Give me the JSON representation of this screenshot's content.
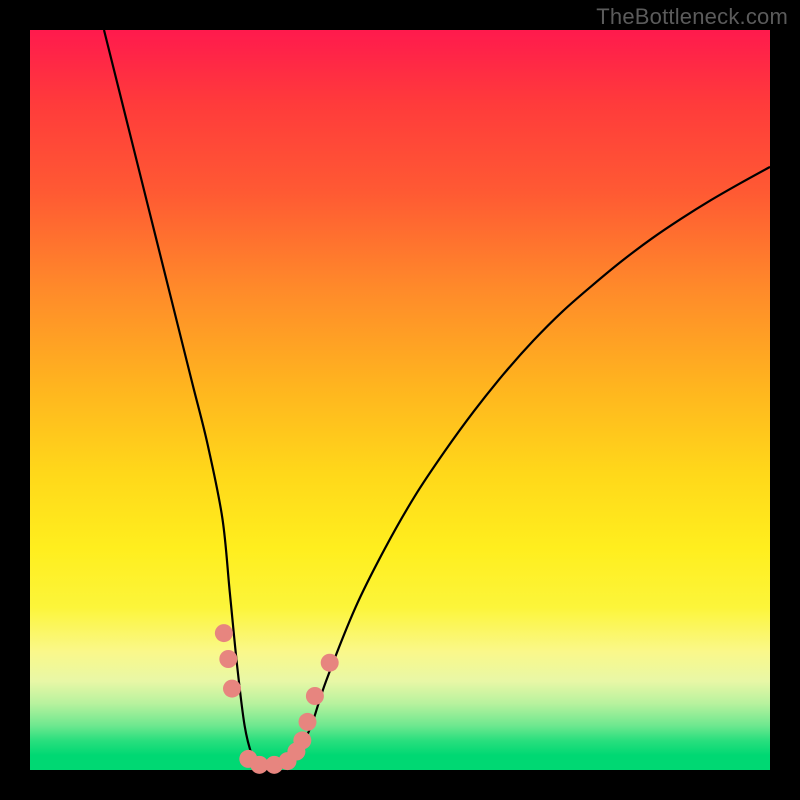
{
  "watermark": "TheBottleneck.com",
  "chart_data": {
    "type": "line",
    "title": "",
    "xlabel": "",
    "ylabel": "",
    "xlim": [
      0,
      100
    ],
    "ylim": [
      0,
      100
    ],
    "series": [
      {
        "name": "curve",
        "x": [
          10,
          12,
          14,
          16,
          18,
          20,
          22,
          24,
          26,
          27,
          28,
          29,
          30,
          31,
          32,
          34,
          36,
          38,
          40,
          44,
          48,
          52,
          56,
          60,
          64,
          68,
          72,
          76,
          80,
          84,
          88,
          92,
          96,
          100
        ],
        "values": [
          100,
          92,
          84,
          76,
          68,
          60,
          52,
          44,
          34,
          24,
          14,
          6,
          2,
          0.5,
          0.5,
          0.5,
          2,
          6,
          12,
          22,
          30,
          37,
          43,
          48.5,
          53.5,
          58,
          62,
          65.5,
          68.8,
          71.8,
          74.5,
          77,
          79.3,
          81.5
        ]
      }
    ],
    "markers": [
      {
        "x": 26.2,
        "y": 18.5
      },
      {
        "x": 26.8,
        "y": 15.0
      },
      {
        "x": 27.3,
        "y": 11.0
      },
      {
        "x": 29.5,
        "y": 1.5
      },
      {
        "x": 31.0,
        "y": 0.7
      },
      {
        "x": 33.0,
        "y": 0.7
      },
      {
        "x": 34.8,
        "y": 1.2
      },
      {
        "x": 36.0,
        "y": 2.5
      },
      {
        "x": 36.8,
        "y": 4.0
      },
      {
        "x": 37.5,
        "y": 6.5
      },
      {
        "x": 38.5,
        "y": 10.0
      },
      {
        "x": 40.5,
        "y": 14.5
      }
    ],
    "marker_color": "#e7857f",
    "curve_color": "#000000",
    "curve_width": 2.2,
    "marker_radius": 9
  }
}
